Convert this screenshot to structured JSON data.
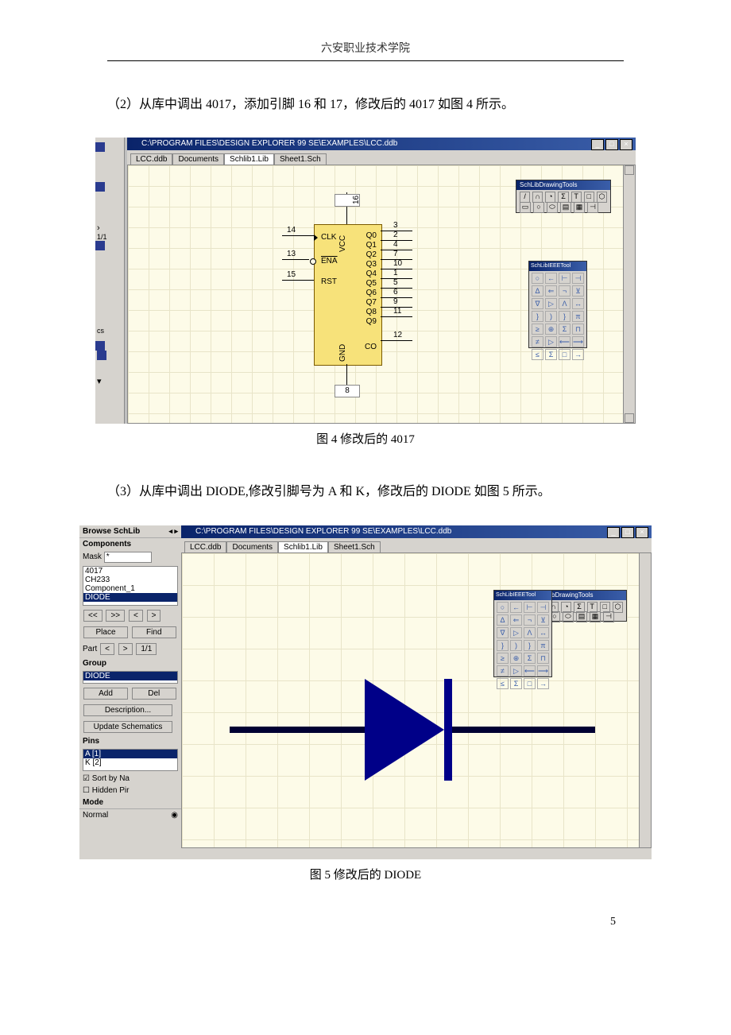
{
  "header": "六安职业技术学院",
  "para1": "（2）从库中调出 4017，添加引脚 16 和 17，修改后的 4017 如图 4 所示。",
  "caption1": "图 4   修改后的 4017",
  "para2": "（3）从库中调出 DIODE,修改引脚号为 A 和 K，修改后的 DIODE 如图 5 所示。",
  "caption2": "图 5   修改后的 DIODE",
  "pagenum": "5",
  "shot1": {
    "title": "C:\\PROGRAM FILES\\DESIGN EXPLORER 99 SE\\EXAMPLES\\LCC.ddb",
    "tabs": [
      "LCC.ddb",
      "Documents",
      "Schlib1.Lib",
      "Sheet1.Sch"
    ],
    "active_tab": 2,
    "palette_draw_title": "SchLibDrawingTools",
    "palette_ieee_title": "SchLibIEEETool",
    "chip": {
      "vcc": "VCC",
      "gnd": "GND",
      "left_pins": [
        {
          "num": "14",
          "name": "CLK",
          "y": 14
        },
        {
          "num": "13",
          "name": "ENA",
          "y": 44
        },
        {
          "num": "15",
          "name": "RST",
          "y": 70
        }
      ],
      "right_pins": [
        {
          "num": "3",
          "name": "Q0"
        },
        {
          "num": "2",
          "name": "Q1"
        },
        {
          "num": "4",
          "name": "Q2"
        },
        {
          "num": "7",
          "name": "Q3"
        },
        {
          "num": "10",
          "name": "Q4"
        },
        {
          "num": "1",
          "name": "Q5"
        },
        {
          "num": "5",
          "name": "Q6"
        },
        {
          "num": "6",
          "name": "Q7"
        },
        {
          "num": "9",
          "name": "Q8"
        },
        {
          "num": "11",
          "name": "Q9"
        },
        {
          "num": "12",
          "name": "CO"
        }
      ],
      "top_pin": "16",
      "bot_pin": "8"
    }
  },
  "shot2": {
    "browse_header": "Browse SchLib",
    "components_label": "Components",
    "mask_label": "Mask",
    "mask_value": "*",
    "components": [
      "4017",
      "CH233",
      "Component_1",
      "DIODE"
    ],
    "selected_component": "DIODE",
    "nav": [
      "<<",
      ">>",
      "<",
      ">"
    ],
    "place": "Place",
    "find": "Find",
    "part_label": "Part",
    "part_nav": [
      "<",
      ">"
    ],
    "part_count": "1/1",
    "group_label": "Group",
    "group_sel": "DIODE",
    "add": "Add",
    "del": "Del",
    "description": "Description...",
    "update": "Update Schematics",
    "pins_label": "Pins",
    "pins": [
      "A  [1]",
      "K  [2]"
    ],
    "sort": "Sort by Na",
    "hidden": "Hidden Pir",
    "mode_label": "Mode",
    "mode_value": "Normal",
    "title": "C:\\PROGRAM FILES\\DESIGN EXPLORER 99 SE\\EXAMPLES\\LCC.ddb",
    "tabs": [
      "LCC.ddb",
      "Documents",
      "Schlib1.Lib",
      "Sheet1.Sch"
    ],
    "active_tab": 2,
    "palette_draw_title": "SchLibDrawingTools",
    "palette_ieee_title": "SchLibIEEETool"
  }
}
